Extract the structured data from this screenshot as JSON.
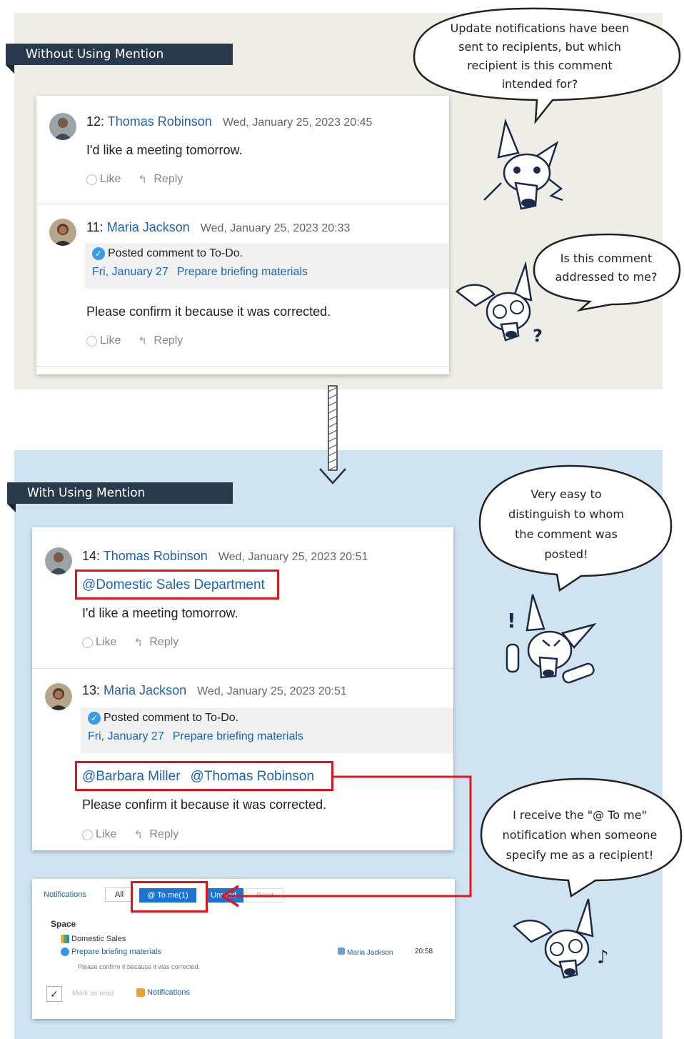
{
  "sections": {
    "before_title": "Without Using Mention",
    "after_title": "With Using Mention"
  },
  "before": {
    "comments": [
      {
        "num": "12:",
        "user": "Thomas Robinson",
        "date": "Wed, January 25, 2023 20:45",
        "body": "I'd like a meeting tomorrow.",
        "like": "Like",
        "reply": "Reply"
      },
      {
        "num": "11:",
        "user": "Maria Jackson",
        "date": "Wed, January 25, 2023 20:33",
        "todo_title": "Posted comment to To-Do.",
        "todo_date": "Fri, January 27",
        "todo_task": "Prepare briefing materials",
        "body": "Please confirm it because it was corrected.",
        "like": "Like",
        "reply": "Reply"
      }
    ]
  },
  "after": {
    "comments": [
      {
        "num": "14:",
        "user": "Thomas Robinson",
        "date": "Wed, January 25, 2023 20:51",
        "mentions": [
          "@Domestic Sales Department"
        ],
        "body": "I'd like a meeting tomorrow.",
        "like": "Like",
        "reply": "Reply"
      },
      {
        "num": "13:",
        "user": "Maria Jackson",
        "date": "Wed, January 25, 2023 20:51",
        "todo_title": "Posted comment to To-Do.",
        "todo_date": "Fri, January 27",
        "todo_task": "Prepare briefing materials",
        "mentions": [
          "@Barbara Miller",
          "@Thomas Robinson"
        ],
        "body": "Please confirm it because it was corrected.",
        "like": "Like",
        "reply": "Reply"
      }
    ]
  },
  "bubbles": {
    "b1": [
      "Update notifications have been",
      "sent to recipients, but which",
      "recipient is this comment",
      "intended for?"
    ],
    "b2": [
      "Is this comment",
      "addressed to me?"
    ],
    "b3": [
      "Very easy to",
      "distinguish to whom",
      "the comment was",
      "posted!"
    ],
    "b4": [
      "I receive the \"@ To me\"",
      "notification when someone",
      "specify me as a recipient!"
    ]
  },
  "notifications": {
    "label": "Notifications",
    "tab_all": "All",
    "tab_tome": "@ To me(1)",
    "tab_unread": "Unread",
    "tab_read": "Read",
    "space_heading": "Space",
    "space_name": "Domestic Sales",
    "item_title": "Prepare briefing materials",
    "item_sender": "Maria Jackson",
    "item_time": "20:58",
    "item_snippet": "Please confirm it because it was corrected.",
    "mark_as_read": "Mark as read",
    "footer_link": "Notifications"
  },
  "colors": {
    "link_blue": "#1a63b8",
    "highlight_red": "#e0141e",
    "tab_navy": "#283a4c",
    "top_panel_bg": "#efeee6",
    "bottom_panel_bg": "#cfe3f1"
  }
}
